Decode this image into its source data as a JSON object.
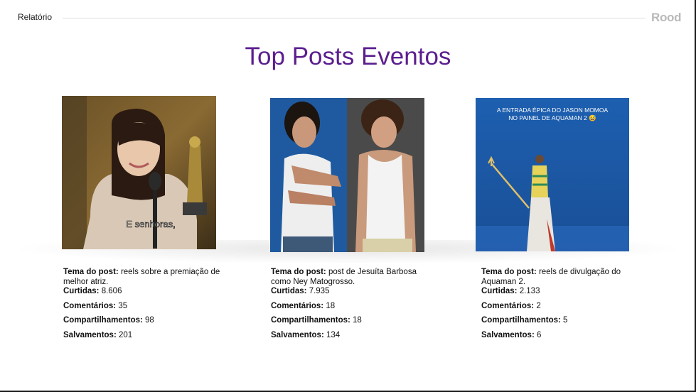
{
  "header": {
    "report_label": "Relatório",
    "logo_text": "Rood"
  },
  "title": "Top Posts Eventos",
  "labels": {
    "tema": "Tema do post:",
    "curtidas": "Curtidas:",
    "comentarios": "Comentários:",
    "compartilhamentos": "Compartilhamentos:",
    "salvamentos": "Salvamentos:"
  },
  "posts": [
    {
      "tema": "reels sobre a premiação de melhor atriz.",
      "curtidas": "8.606",
      "comentarios": "35",
      "compartilhamentos": "98",
      "salvamentos": "201",
      "caption": "E senhoras,"
    },
    {
      "tema": "post de Jesuíta Barbosa como Ney Matogrosso.",
      "curtidas": "7.935",
      "comentarios": "18",
      "compartilhamentos": "18",
      "salvamentos": "134"
    },
    {
      "tema": "reels de divulgação do Aquaman 2.",
      "curtidas": "2.133",
      "comentarios": "2",
      "compartilhamentos": "5",
      "salvamentos": "6",
      "overlay_line1": "A ENTRADA ÉPICA DO JASON MOMOA",
      "overlay_line2": "NO PAINEL DE AQUAMAN 2 😅"
    }
  ],
  "colors": {
    "title": "#5b1e8e",
    "logo": "#b9b9b9",
    "post3_bg": "#1d5fb0"
  }
}
